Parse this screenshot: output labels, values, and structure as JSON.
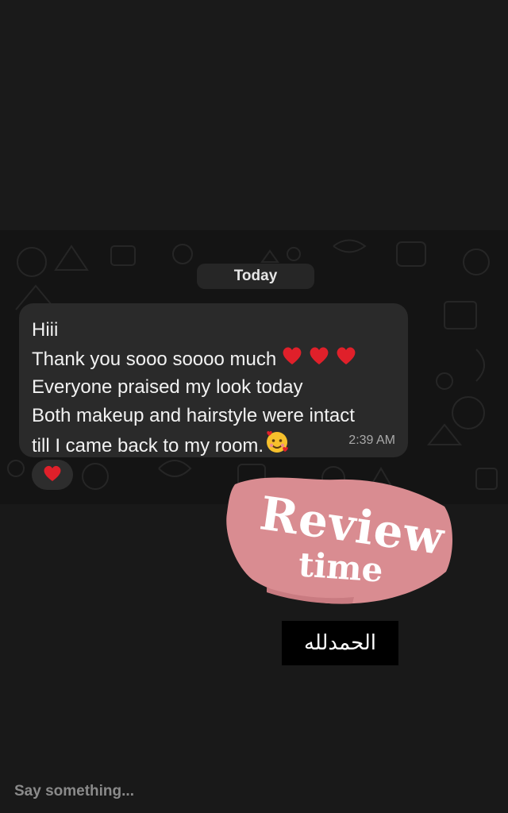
{
  "chat": {
    "date_label": "Today",
    "message": {
      "lines": [
        "Hiii",
        "Thank you sooo soooo much",
        "Everyone praised my look today",
        "Both makeup and hairstyle were intact",
        "till I came back to my room."
      ],
      "time": "2:39 AM"
    },
    "reaction": "heart",
    "icons": {
      "heart": "red-heart-icon",
      "face": "smiling-face-with-hearts-icon"
    }
  },
  "stickers": {
    "review_word": "Review",
    "time_word": "time",
    "arabic_text": "الحمدلله"
  },
  "reply": {
    "placeholder": "Say something..."
  },
  "colors": {
    "background": "#191919",
    "bubble": "#2a2a2a",
    "heart": "#e0202a",
    "sticker_pink": "#d98c91"
  }
}
